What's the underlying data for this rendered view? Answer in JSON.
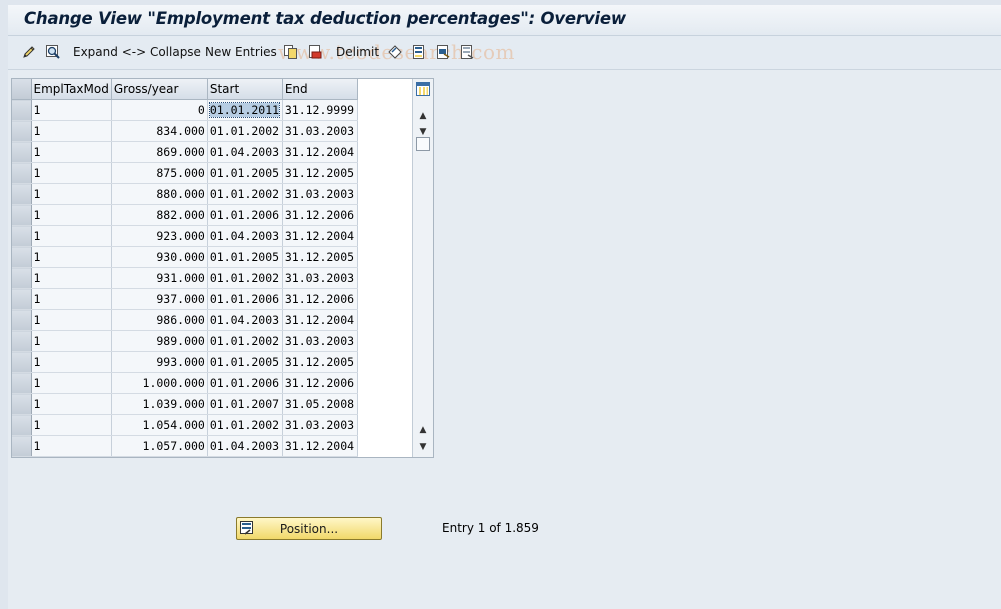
{
  "window": {
    "title": "Change View \"Employment tax deduction percentages\": Overview"
  },
  "toolbar": {
    "expand_collapse_label": "Expand <-> Collapse",
    "new_entries_label": "New Entries",
    "delimit_label": "Delimit",
    "watermark": "www.tcodesearch.com"
  },
  "table": {
    "columns": [
      "EmplTaxMod",
      "Gross/year",
      "Start",
      "End"
    ],
    "rows": [
      {
        "mod": "1",
        "gross": "0",
        "start": "01.01.2011",
        "end": "31.12.9999"
      },
      {
        "mod": "1",
        "gross": "834.000",
        "start": "01.01.2002",
        "end": "31.03.2003"
      },
      {
        "mod": "1",
        "gross": "869.000",
        "start": "01.04.2003",
        "end": "31.12.2004"
      },
      {
        "mod": "1",
        "gross": "875.000",
        "start": "01.01.2005",
        "end": "31.12.2005"
      },
      {
        "mod": "1",
        "gross": "880.000",
        "start": "01.01.2002",
        "end": "31.03.2003"
      },
      {
        "mod": "1",
        "gross": "882.000",
        "start": "01.01.2006",
        "end": "31.12.2006"
      },
      {
        "mod": "1",
        "gross": "923.000",
        "start": "01.04.2003",
        "end": "31.12.2004"
      },
      {
        "mod": "1",
        "gross": "930.000",
        "start": "01.01.2005",
        "end": "31.12.2005"
      },
      {
        "mod": "1",
        "gross": "931.000",
        "start": "01.01.2002",
        "end": "31.03.2003"
      },
      {
        "mod": "1",
        "gross": "937.000",
        "start": "01.01.2006",
        "end": "31.12.2006"
      },
      {
        "mod": "1",
        "gross": "986.000",
        "start": "01.04.2003",
        "end": "31.12.2004"
      },
      {
        "mod": "1",
        "gross": "989.000",
        "start": "01.01.2002",
        "end": "31.03.2003"
      },
      {
        "mod": "1",
        "gross": "993.000",
        "start": "01.01.2005",
        "end": "31.12.2005"
      },
      {
        "mod": "1",
        "gross": "1.000.000",
        "start": "01.01.2006",
        "end": "31.12.2006"
      },
      {
        "mod": "1",
        "gross": "1.039.000",
        "start": "01.01.2007",
        "end": "31.05.2008"
      },
      {
        "mod": "1",
        "gross": "1.054.000",
        "start": "01.01.2002",
        "end": "31.03.2003"
      },
      {
        "mod": "1",
        "gross": "1.057.000",
        "start": "01.04.2003",
        "end": "31.12.2004"
      }
    ]
  },
  "footer": {
    "position_button_label": "Position...",
    "entry_info": "Entry 1 of 1.859"
  },
  "colors": {
    "accent": "#f1d86a",
    "header_bg": "#d5dee8",
    "selection": "#b7cde3"
  }
}
